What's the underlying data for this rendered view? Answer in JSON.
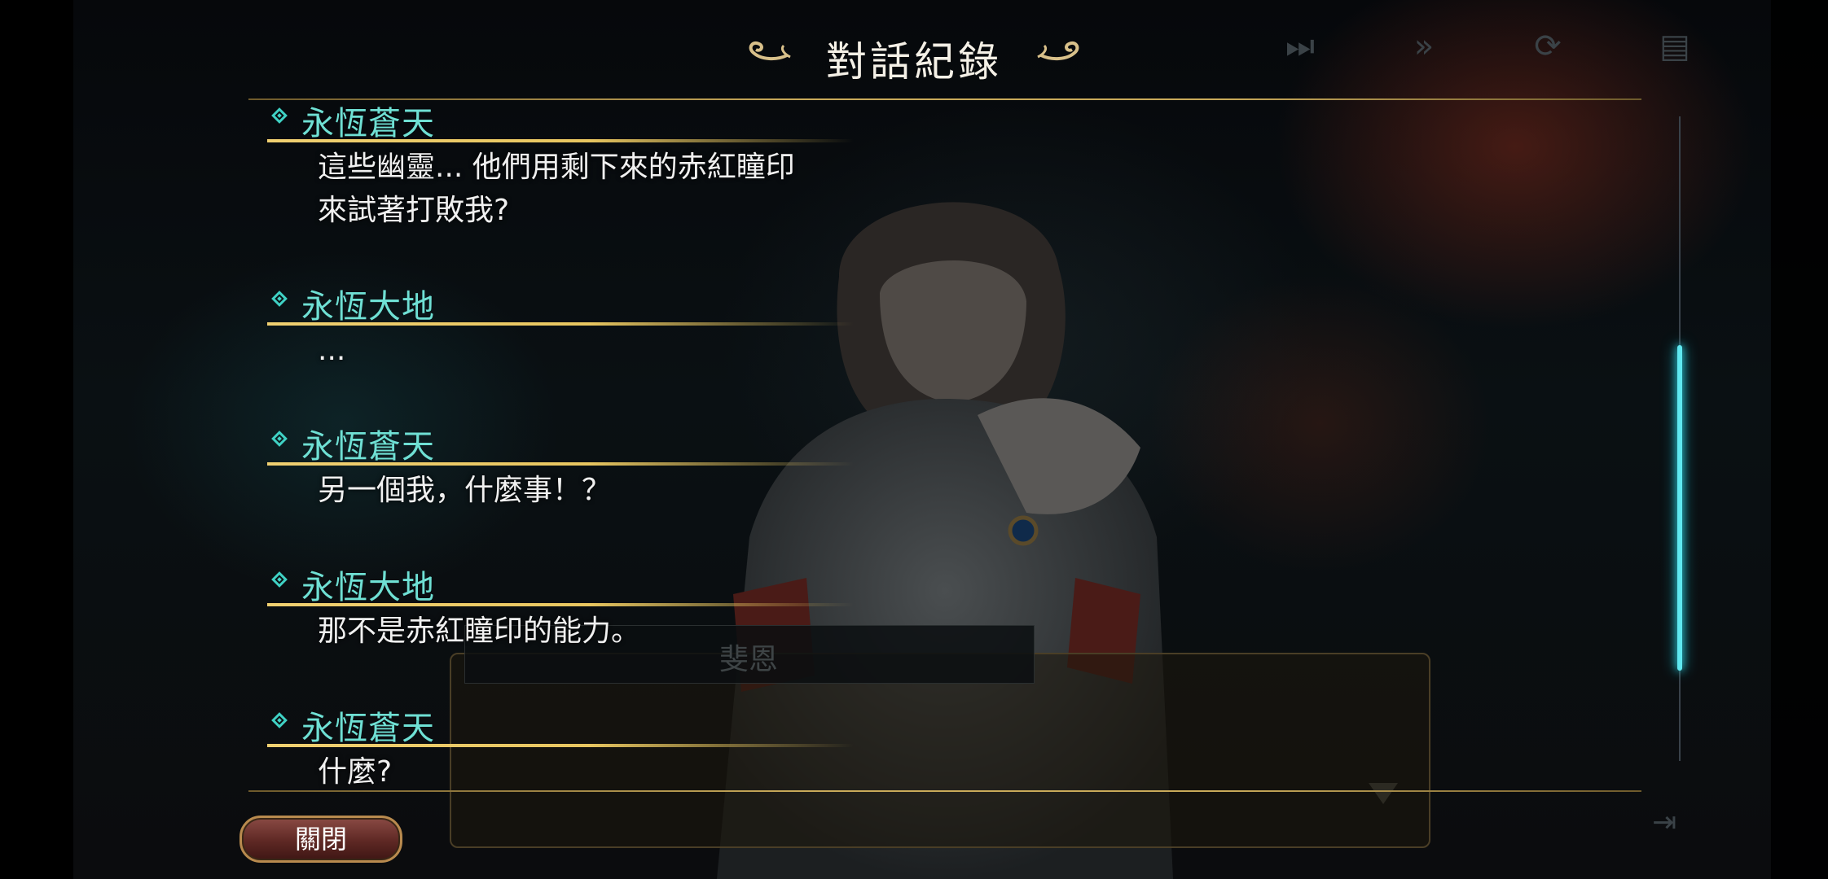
{
  "title": "對話紀錄",
  "toolbar": {
    "icons": [
      "fast-forward-icon",
      "skip-icon",
      "auto-icon",
      "log-icon"
    ]
  },
  "background": {
    "name_box_text": "斐恩"
  },
  "log": [
    {
      "speaker": "永恆蒼天",
      "text": "這些幽靈... 他們用剩下來的赤紅瞳印\n來試著打敗我?"
    },
    {
      "speaker": "永恆大地",
      "text": "..."
    },
    {
      "speaker": "永恆蒼天",
      "text": "另一個我，什麼事！？"
    },
    {
      "speaker": "永恆大地",
      "text": "那不是赤紅瞳印的能力。"
    },
    {
      "speaker": "永恆蒼天",
      "text": "什麼?"
    }
  ],
  "scroll": {
    "position_fraction": 0.35,
    "visible_fraction": 0.5
  },
  "close_label": "關閉",
  "colors": {
    "speaker_name": "#6fe0d4",
    "gold_rule": "#c9aa5a",
    "scroll_thumb": "#5fe8f0",
    "close_button": "#5e2824"
  }
}
